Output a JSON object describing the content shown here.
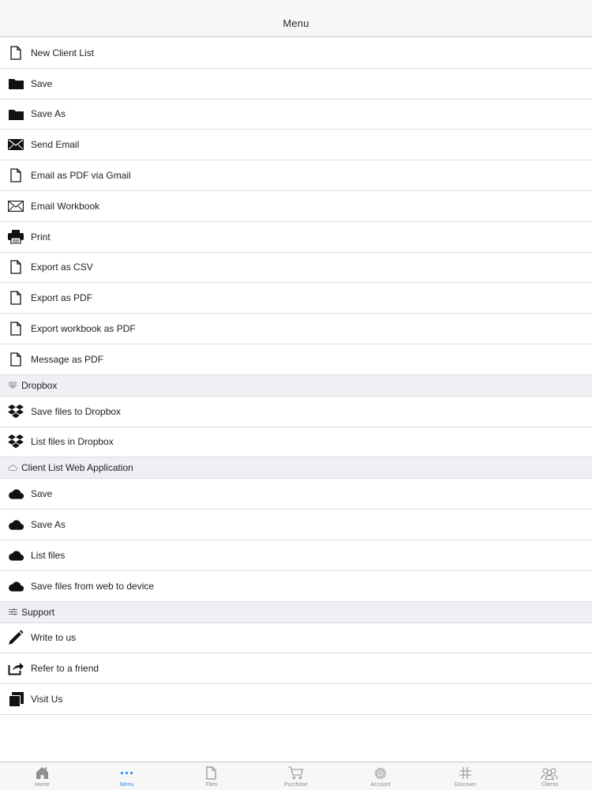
{
  "nav": {
    "title": "Menu"
  },
  "menu": {
    "main_items": [
      {
        "label": "New Client List",
        "icon": "document-icon"
      },
      {
        "label": "Save",
        "icon": "folder-icon"
      },
      {
        "label": "Save As",
        "icon": "folder-icon"
      },
      {
        "label": "Send Email",
        "icon": "envelope-filled-icon"
      },
      {
        "label": "Email as PDF via Gmail",
        "icon": "document-icon"
      },
      {
        "label": "Email Workbook",
        "icon": "envelope-outline-icon"
      },
      {
        "label": "Print",
        "icon": "printer-icon"
      },
      {
        "label": "Export as CSV",
        "icon": "document-icon"
      },
      {
        "label": "Export as PDF",
        "icon": "document-icon"
      },
      {
        "label": "Export workbook as PDF",
        "icon": "document-icon"
      },
      {
        "label": "Message as PDF",
        "icon": "document-icon"
      }
    ],
    "dropbox": {
      "header": "Dropbox",
      "items": [
        {
          "label": "Save files to Dropbox",
          "icon": "dropbox-icon"
        },
        {
          "label": "List files in Dropbox",
          "icon": "dropbox-icon"
        }
      ]
    },
    "web": {
      "header": "Client List Web Application",
      "items": [
        {
          "label": "Save",
          "icon": "cloud-icon"
        },
        {
          "label": "Save As",
          "icon": "cloud-icon"
        },
        {
          "label": "List files",
          "icon": "cloud-icon"
        },
        {
          "label": "Save files from web to device",
          "icon": "cloud-icon"
        }
      ]
    },
    "support": {
      "header": "Support",
      "items": [
        {
          "label": "Write to us",
          "icon": "pencil-icon"
        },
        {
          "label": "Refer to a friend",
          "icon": "share-icon"
        },
        {
          "label": "Visit Us",
          "icon": "pages-icon"
        }
      ]
    }
  },
  "tabs": [
    {
      "label": "Home",
      "icon": "home-icon"
    },
    {
      "label": "Menu",
      "icon": "more-dots-icon",
      "active": true
    },
    {
      "label": "Files",
      "icon": "file-icon"
    },
    {
      "label": "Purchase",
      "icon": "cart-icon"
    },
    {
      "label": "Account",
      "icon": "gear-icon"
    },
    {
      "label": "Discover",
      "icon": "hashtag-icon"
    },
    {
      "label": "Clients",
      "icon": "people-icon"
    }
  ],
  "colors": {
    "active_tab": "#3a8ee6",
    "inactive_tab": "#8e8e93",
    "section_bg": "#efeff4"
  }
}
